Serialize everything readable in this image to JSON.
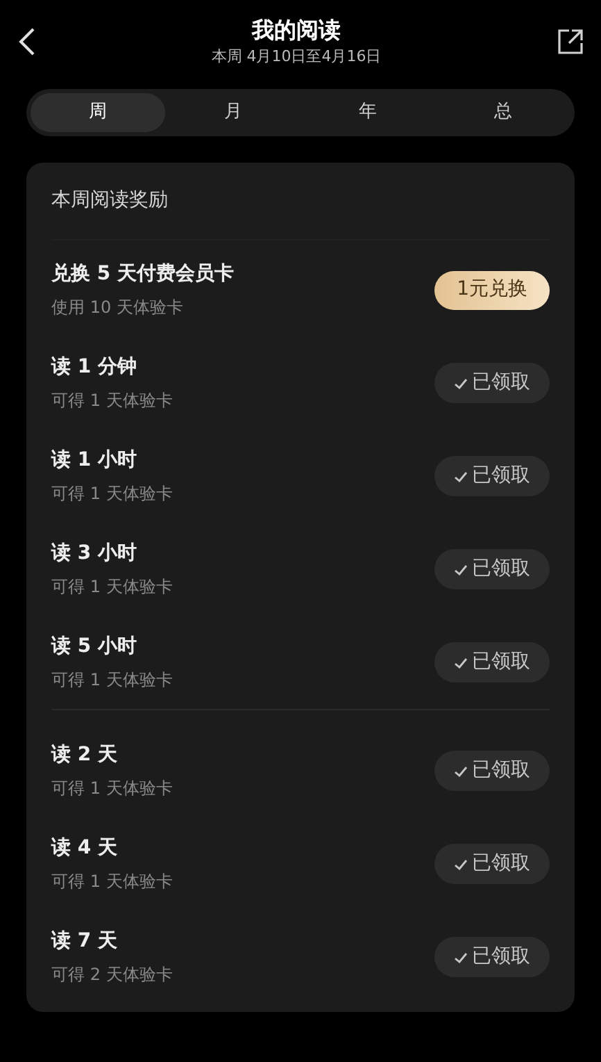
{
  "header": {
    "title": "我的阅读",
    "subtitle": "本周 4月10日至4月16日"
  },
  "tabs": [
    {
      "label": "周",
      "selected": true
    },
    {
      "label": "月",
      "selected": false
    },
    {
      "label": "年",
      "selected": false
    },
    {
      "label": "总",
      "selected": false
    }
  ],
  "card": {
    "title": "本周阅读奖励",
    "groups": [
      {
        "items": [
          {
            "title": "兑换 5 天付费会员卡",
            "subtitle": "使用 10 天体验卡",
            "kind": "exchange",
            "button": "1元兑换"
          },
          {
            "title": "读 1 分钟",
            "subtitle": "可得 1 天体验卡",
            "kind": "claimed",
            "button": "已领取"
          },
          {
            "title": "读 1 小时",
            "subtitle": "可得 1 天体验卡",
            "kind": "claimed",
            "button": "已领取"
          },
          {
            "title": "读 3 小时",
            "subtitle": "可得 1 天体验卡",
            "kind": "claimed",
            "button": "已领取"
          },
          {
            "title": "读 5 小时",
            "subtitle": "可得 1 天体验卡",
            "kind": "claimed",
            "button": "已领取"
          }
        ]
      },
      {
        "items": [
          {
            "title": "读 2 天",
            "subtitle": "可得 1 天体验卡",
            "kind": "claimed",
            "button": "已领取"
          },
          {
            "title": "读 4 天",
            "subtitle": "可得 1 天体验卡",
            "kind": "claimed",
            "button": "已领取"
          },
          {
            "title": "读 7 天",
            "subtitle": "可得 2 天体验卡",
            "kind": "claimed",
            "button": "已领取"
          }
        ]
      }
    ]
  }
}
